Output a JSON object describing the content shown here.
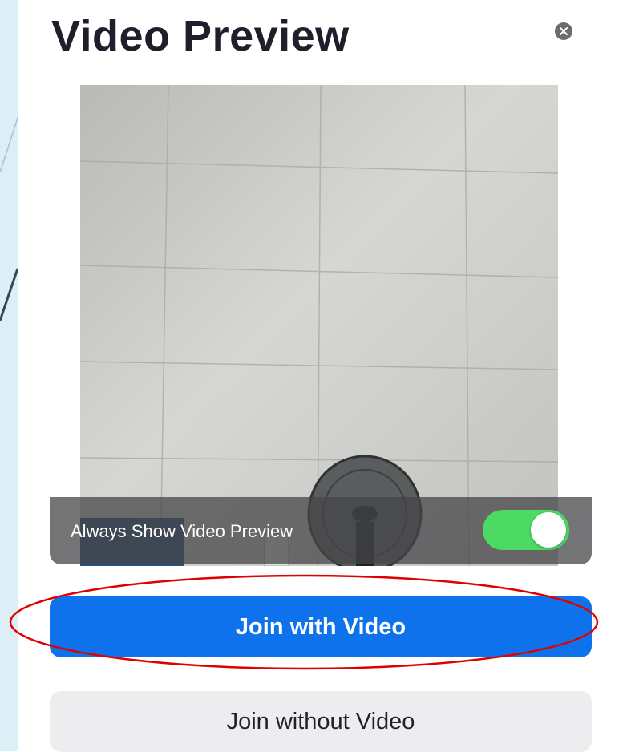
{
  "dialog": {
    "title": "Video Preview",
    "close_icon": "close-circle-icon",
    "preview": {
      "toggle_label": "Always Show Video Preview",
      "toggle_on": true
    },
    "buttons": {
      "join_with_video": "Join with Video",
      "join_without_video": "Join without Video"
    }
  },
  "colors": {
    "primary": "#0e72ed",
    "toggle_on": "#4cd964",
    "secondary_button": "#ededf0",
    "annotation": "#e00000"
  }
}
